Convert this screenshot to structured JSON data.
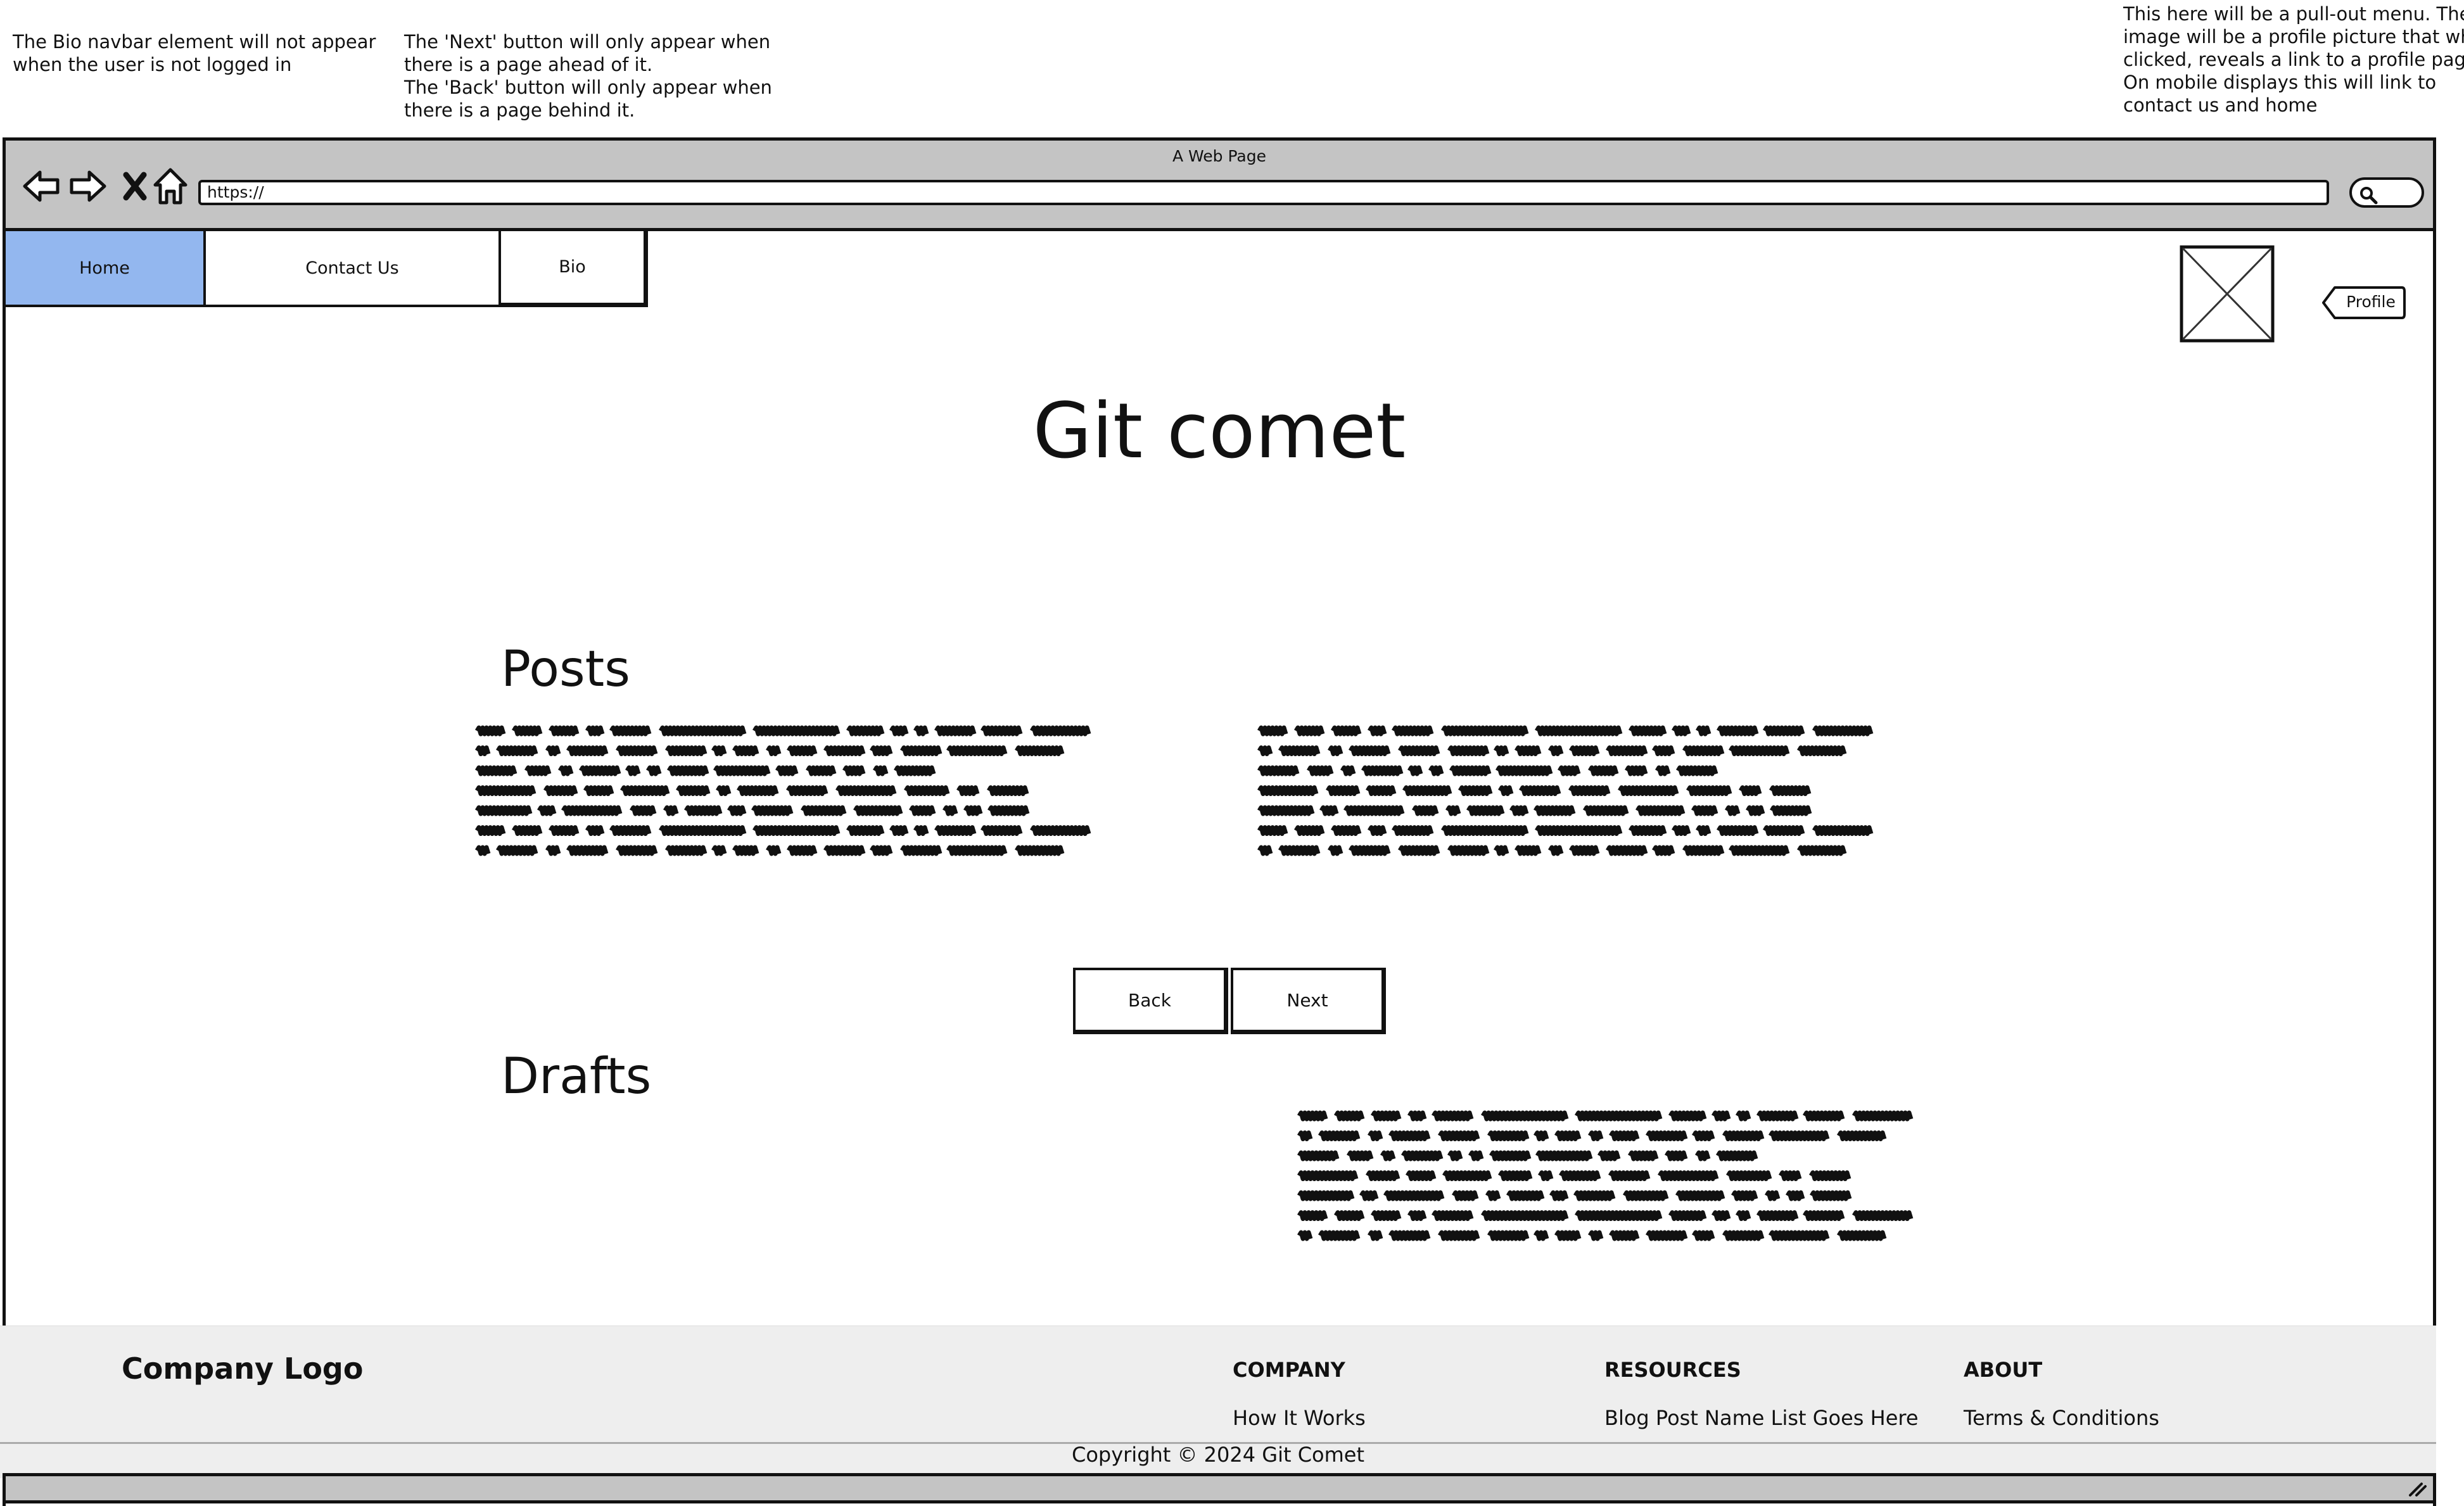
{
  "annotations": {
    "bio_note": [
      "The Bio navbar element will not appear",
      "when the user is not logged in"
    ],
    "nav_note": [
      "The 'Next' button will only appear when",
      "there is a page ahead of it.",
      "The 'Back' button will only appear when",
      "there is a page behind it."
    ],
    "menu_note": [
      "This here will be a pull-out menu. The",
      "image will be a profile picture that when",
      "clicked, reveals a link to a profile page.",
      "On mobile displays this will link to",
      "contact us and home"
    ]
  },
  "browser": {
    "window_title": "A Web Page",
    "url": "https://",
    "icons": [
      "back-arrow-icon",
      "forward-arrow-icon",
      "close-icon",
      "home-icon",
      "search-icon"
    ]
  },
  "navbar": {
    "tabs": [
      {
        "label": "Home",
        "active": true
      },
      {
        "label": "Contact Us",
        "active": false
      },
      {
        "label": "Bio",
        "active": false
      }
    ],
    "active_color": "#93b7ef"
  },
  "profile": {
    "button_label": "Profile",
    "avatar_icon": "image-placeholder-icon"
  },
  "main": {
    "title": "Git comet",
    "posts_heading": "Posts",
    "drafts_heading": "Drafts",
    "back_label": "Back",
    "next_label": "Next"
  },
  "footer": {
    "logo": "Company Logo",
    "columns": [
      {
        "heading": "COMPANY",
        "link": "How It Works"
      },
      {
        "heading": "RESOURCES",
        "link": "Blog Post Name List Goes Here"
      },
      {
        "heading": "ABOUT",
        "link": "Terms & Conditions"
      }
    ],
    "copyright": "Copyright © 2024 Git Comet",
    "background": "#eeeeee"
  }
}
